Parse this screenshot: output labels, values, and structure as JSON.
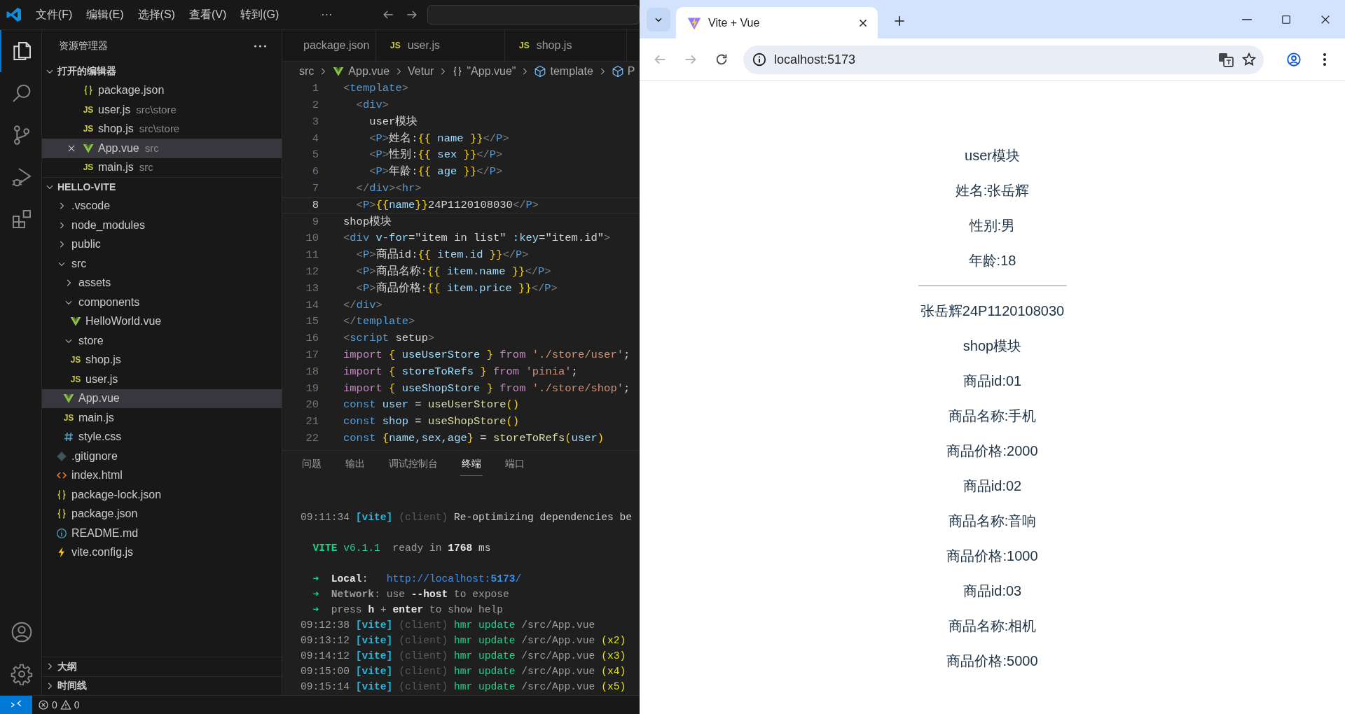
{
  "vscode": {
    "menu": [
      "文件(F)",
      "编辑(E)",
      "选择(S)",
      "查看(V)",
      "转到(G)",
      "···"
    ],
    "activity_bar": [
      {
        "kind": "explorer",
        "selected": true
      },
      {
        "kind": "search",
        "selected": false
      },
      {
        "kind": "source-control",
        "selected": false
      },
      {
        "kind": "run-debug",
        "selected": false
      },
      {
        "kind": "extensions",
        "selected": false
      }
    ],
    "sidebar": {
      "title": "资源管理器",
      "sections": [
        {
          "kind": "open-editors",
          "title": "打开的编辑器",
          "expanded": true,
          "items": [
            {
              "kind": "json",
              "name": "package.json",
              "selected": false
            },
            {
              "kind": "js",
              "icon_text": "JS",
              "name": "user.js",
              "path": "src\\store",
              "selected": false
            },
            {
              "kind": "js",
              "icon_text": "JS",
              "name": "shop.js",
              "path": "src\\store",
              "selected": false
            },
            {
              "kind": "vue",
              "name": "App.vue",
              "path": "src",
              "selected": true
            },
            {
              "kind": "js",
              "icon_text": "JS",
              "name": "main.js",
              "path": "src",
              "selected": false
            }
          ]
        },
        {
          "kind": "tree",
          "title": "HELLO-VITE",
          "expanded": true,
          "items": [
            {
              "kind": "folder",
              "name": ".vscode",
              "expanded": false,
              "selected": false
            },
            {
              "kind": "folder",
              "name": "node_modules",
              "expanded": false,
              "selected": false
            },
            {
              "kind": "folder",
              "name": "public",
              "expanded": false,
              "selected": false
            },
            {
              "kind": "folder",
              "name": "src",
              "expanded": true,
              "selected": false,
              "children": [
                {
                  "kind": "folder",
                  "name": "assets",
                  "expanded": false,
                  "selected": false
                },
                {
                  "kind": "folder",
                  "name": "components",
                  "expanded": true,
                  "selected": false,
                  "children": [
                    {
                      "kind": "vue",
                      "name": "HelloWorld.vue",
                      "selected": false
                    }
                  ]
                },
                {
                  "kind": "folder",
                  "name": "store",
                  "expanded": true,
                  "selected": false,
                  "children": [
                    {
                      "kind": "js",
                      "icon_text": "JS",
                      "name": "shop.js",
                      "selected": false
                    },
                    {
                      "kind": "js",
                      "icon_text": "JS",
                      "name": "user.js",
                      "selected": false
                    }
                  ]
                },
                {
                  "kind": "vue",
                  "name": "App.vue",
                  "selected": true
                },
                {
                  "kind": "js",
                  "icon_text": "JS",
                  "name": "main.js",
                  "selected": false
                },
                {
                  "kind": "css",
                  "name": "style.css",
                  "selected": false
                }
              ]
            },
            {
              "kind": "git",
              "name": ".gitignore",
              "selected": false
            },
            {
              "kind": "html",
              "name": "index.html",
              "selected": false
            },
            {
              "kind": "json",
              "name": "package-lock.json",
              "selected": false
            },
            {
              "kind": "json",
              "name": "package.json",
              "selected": false
            },
            {
              "kind": "info",
              "name": "README.md",
              "selected": false
            },
            {
              "kind": "vite",
              "name": "vite.config.js",
              "selected": false
            }
          ]
        },
        {
          "title": "大纲",
          "expanded": false
        },
        {
          "title": "时间线",
          "expanded": false
        }
      ]
    },
    "editor_tabs": [
      {
        "kind": "json",
        "label": "package.json",
        "selected": false
      },
      {
        "kind": "js",
        "icon_text": "JS",
        "label": "user.js",
        "selected": false
      },
      {
        "kind": "js",
        "icon_text": "JS",
        "label": "shop.js",
        "selected": false
      }
    ],
    "breadcrumb": [
      {
        "kind": "plain",
        "text": "src"
      },
      {
        "kind": "vue",
        "text": "App.vue"
      },
      {
        "kind": "plain",
        "text": "Vetur"
      },
      {
        "kind": "braces",
        "text": "\"App.vue\""
      },
      {
        "kind": "cube",
        "text": "template"
      },
      {
        "kind": "cube",
        "text": "P"
      }
    ],
    "code": [
      {
        "number": "1",
        "current": false,
        "segments": [
          {
            "text": "<",
            "kind": "p"
          },
          {
            "text": "template",
            "kind": "tag"
          },
          {
            "text": ">",
            "kind": "p"
          }
        ]
      },
      {
        "number": "2",
        "current": false,
        "segments": [
          {
            "text": "  <",
            "kind": "p"
          },
          {
            "text": "div",
            "kind": "tag"
          },
          {
            "text": ">",
            "kind": "p"
          }
        ]
      },
      {
        "number": "3",
        "current": false,
        "segments": [
          {
            "text": "    user模块",
            "kind": "tx"
          }
        ]
      },
      {
        "number": "4",
        "current": false,
        "segments": [
          {
            "text": "    <",
            "kind": "p"
          },
          {
            "text": "P",
            "kind": "tag"
          },
          {
            "text": ">",
            "kind": "p"
          },
          {
            "text": "姓名:",
            "kind": "tx"
          },
          {
            "text": "{{",
            "kind": "br"
          },
          {
            "text": " name ",
            "kind": "v"
          },
          {
            "text": "}}",
            "kind": "br"
          },
          {
            "text": "</",
            "kind": "p"
          },
          {
            "text": "P",
            "kind": "tag"
          },
          {
            "text": ">",
            "kind": "p"
          }
        ]
      },
      {
        "number": "5",
        "current": false,
        "segments": [
          {
            "text": "    <",
            "kind": "p"
          },
          {
            "text": "P",
            "kind": "tag"
          },
          {
            "text": ">",
            "kind": "p"
          },
          {
            "text": "性别:",
            "kind": "tx"
          },
          {
            "text": "{{",
            "kind": "br"
          },
          {
            "text": " sex ",
            "kind": "v"
          },
          {
            "text": "}}",
            "kind": "br"
          },
          {
            "text": "</",
            "kind": "p"
          },
          {
            "text": "P",
            "kind": "tag"
          },
          {
            "text": ">",
            "kind": "p"
          }
        ]
      },
      {
        "number": "6",
        "current": false,
        "segments": [
          {
            "text": "    <",
            "kind": "p"
          },
          {
            "text": "P",
            "kind": "tag"
          },
          {
            "text": ">",
            "kind": "p"
          },
          {
            "text": "年龄:",
            "kind": "tx"
          },
          {
            "text": "{{",
            "kind": "br"
          },
          {
            "text": " age ",
            "kind": "v"
          },
          {
            "text": "}}",
            "kind": "br"
          },
          {
            "text": "</",
            "kind": "p"
          },
          {
            "text": "P",
            "kind": "tag"
          },
          {
            "text": ">",
            "kind": "p"
          }
        ]
      },
      {
        "number": "7",
        "current": false,
        "segments": [
          {
            "text": "  </",
            "kind": "p"
          },
          {
            "text": "div",
            "kind": "tag"
          },
          {
            "text": "><",
            "kind": "p"
          },
          {
            "text": "hr",
            "kind": "tag"
          },
          {
            "text": ">",
            "kind": "p"
          }
        ]
      },
      {
        "number": "8",
        "current": true,
        "segments": [
          {
            "text": "  <",
            "kind": "p"
          },
          {
            "text": "P",
            "kind": "tag"
          },
          {
            "text": ">",
            "kind": "p"
          },
          {
            "text": "{{",
            "kind": "br"
          },
          {
            "text": "name",
            "kind": "v"
          },
          {
            "text": "}}",
            "kind": "br"
          },
          {
            "text": "24P1120108030",
            "kind": "tx"
          },
          {
            "text": "</",
            "kind": "p"
          },
          {
            "text": "P",
            "kind": "tag"
          },
          {
            "text": ">",
            "kind": "p"
          }
        ]
      },
      {
        "number": "9",
        "current": false,
        "segments": [
          {
            "text": "shop模块",
            "kind": "tx"
          }
        ]
      },
      {
        "number": "10",
        "current": false,
        "segments": [
          {
            "text": "<",
            "kind": "p"
          },
          {
            "text": "div",
            "kind": "tag"
          },
          {
            "text": " v-for",
            "kind": "v"
          },
          {
            "text": "=\"item in list\"",
            "kind": "tx"
          },
          {
            "text": " :key",
            "kind": "v"
          },
          {
            "text": "=\"item.id\"",
            "kind": "tx"
          },
          {
            "text": ">",
            "kind": "p"
          }
        ]
      },
      {
        "number": "11",
        "current": false,
        "segments": [
          {
            "text": "  <",
            "kind": "p"
          },
          {
            "text": "P",
            "kind": "tag"
          },
          {
            "text": ">",
            "kind": "p"
          },
          {
            "text": "商品id:",
            "kind": "tx"
          },
          {
            "text": "{{",
            "kind": "br"
          },
          {
            "text": " item.id ",
            "kind": "v"
          },
          {
            "text": "}}",
            "kind": "br"
          },
          {
            "text": "</",
            "kind": "p"
          },
          {
            "text": "P",
            "kind": "tag"
          },
          {
            "text": ">",
            "kind": "p"
          }
        ]
      },
      {
        "number": "12",
        "current": false,
        "segments": [
          {
            "text": "  <",
            "kind": "p"
          },
          {
            "text": "P",
            "kind": "tag"
          },
          {
            "text": ">",
            "kind": "p"
          },
          {
            "text": "商品名称:",
            "kind": "tx"
          },
          {
            "text": "{{",
            "kind": "br"
          },
          {
            "text": " item.name ",
            "kind": "v"
          },
          {
            "text": "}}",
            "kind": "br"
          },
          {
            "text": "</",
            "kind": "p"
          },
          {
            "text": "P",
            "kind": "tag"
          },
          {
            "text": ">",
            "kind": "p"
          }
        ]
      },
      {
        "number": "13",
        "current": false,
        "segments": [
          {
            "text": "  <",
            "kind": "p"
          },
          {
            "text": "P",
            "kind": "tag"
          },
          {
            "text": ">",
            "kind": "p"
          },
          {
            "text": "商品价格:",
            "kind": "tx"
          },
          {
            "text": "{{",
            "kind": "br"
          },
          {
            "text": " item.price ",
            "kind": "v"
          },
          {
            "text": "}}",
            "kind": "br"
          },
          {
            "text": "</",
            "kind": "p"
          },
          {
            "text": "P",
            "kind": "tag"
          },
          {
            "text": ">",
            "kind": "p"
          }
        ]
      },
      {
        "number": "14",
        "current": false,
        "segments": [
          {
            "text": "</",
            "kind": "p"
          },
          {
            "text": "div",
            "kind": "tag"
          },
          {
            "text": ">",
            "kind": "p"
          }
        ]
      },
      {
        "number": "15",
        "current": false,
        "segments": [
          {
            "text": "</",
            "kind": "p"
          },
          {
            "text": "template",
            "kind": "tag"
          },
          {
            "text": ">",
            "kind": "p"
          }
        ]
      },
      {
        "number": "16",
        "current": false,
        "segments": [
          {
            "text": "<",
            "kind": "p"
          },
          {
            "text": "script",
            "kind": "tag"
          },
          {
            "text": " setup",
            "kind": "tx"
          },
          {
            "text": ">",
            "kind": "p"
          }
        ]
      },
      {
        "number": "17",
        "current": false,
        "segments": [
          {
            "text": "import",
            "kind": "kw"
          },
          {
            "text": " {",
            "kind": "br"
          },
          {
            "text": " useUserStore ",
            "kind": "v"
          },
          {
            "text": "}",
            "kind": "br"
          },
          {
            "text": " from",
            "kind": "kw"
          },
          {
            "text": " './store/user'",
            "kind": "s"
          },
          {
            "text": ";",
            "kind": "tx"
          }
        ]
      },
      {
        "number": "18",
        "current": false,
        "segments": [
          {
            "text": "import",
            "kind": "kw"
          },
          {
            "text": " {",
            "kind": "br"
          },
          {
            "text": " storeToRefs ",
            "kind": "v"
          },
          {
            "text": "}",
            "kind": "br"
          },
          {
            "text": " from",
            "kind": "kw"
          },
          {
            "text": " 'pinia'",
            "kind": "s"
          },
          {
            "text": ";",
            "kind": "tx"
          }
        ]
      },
      {
        "number": "19",
        "current": false,
        "segments": [
          {
            "text": "import",
            "kind": "kw"
          },
          {
            "text": " {",
            "kind": "br"
          },
          {
            "text": " useShopStore ",
            "kind": "v"
          },
          {
            "text": "}",
            "kind": "br"
          },
          {
            "text": " from",
            "kind": "kw"
          },
          {
            "text": " './store/shop'",
            "kind": "s"
          },
          {
            "text": ";",
            "kind": "tx"
          }
        ]
      },
      {
        "number": "20",
        "current": false,
        "segments": [
          {
            "text": "const",
            "kind": "c"
          },
          {
            "text": " user",
            "kind": "v"
          },
          {
            "text": " = ",
            "kind": "tx"
          },
          {
            "text": "useUserStore",
            "kind": "fn"
          },
          {
            "text": "()",
            "kind": "br"
          }
        ]
      },
      {
        "number": "21",
        "current": false,
        "segments": [
          {
            "text": "const",
            "kind": "c"
          },
          {
            "text": " shop",
            "kind": "v"
          },
          {
            "text": " = ",
            "kind": "tx"
          },
          {
            "text": "useShopStore",
            "kind": "fn"
          },
          {
            "text": "()",
            "kind": "br"
          }
        ]
      },
      {
        "number": "22",
        "current": false,
        "segments": [
          {
            "text": "const",
            "kind": "c"
          },
          {
            "text": " {",
            "kind": "br"
          },
          {
            "text": "name,sex,age",
            "kind": "v"
          },
          {
            "text": "}",
            "kind": "br"
          },
          {
            "text": " = ",
            "kind": "tx"
          },
          {
            "text": "storeToRefs",
            "kind": "fn"
          },
          {
            "text": "(",
            "kind": "br"
          },
          {
            "text": "user",
            "kind": "v"
          },
          {
            "text": ")",
            "kind": "br"
          }
        ]
      }
    ],
    "panel_tabs": [
      {
        "label": "问题",
        "selected": false
      },
      {
        "label": "输出",
        "selected": false
      },
      {
        "label": "调试控制台",
        "selected": false
      },
      {
        "label": "终端",
        "selected": true
      },
      {
        "label": "端口",
        "selected": false
      }
    ],
    "terminal": [
      {
        "kind": "log",
        "segments": [
          {
            "text": "09:11:34 ",
            "kind": "dim"
          },
          {
            "text": "[vite]",
            "kind": "cyan"
          },
          {
            "text": " (client) ",
            "kind": "dark"
          },
          {
            "text": "Re-optimizing dependencies be",
            "kind": "tx"
          }
        ]
      },
      {
        "kind": "blank"
      },
      {
        "kind": "log",
        "segments": [
          {
            "text": "  VITE",
            "kind": "greenb"
          },
          {
            "text": " v6.1.1",
            "kind": "green"
          },
          {
            "text": "  ready in ",
            "kind": "dim"
          },
          {
            "text": "1768",
            "kind": "bold"
          },
          {
            "text": " ms",
            "kind": "tx"
          }
        ]
      },
      {
        "kind": "blank"
      },
      {
        "kind": "log",
        "segments": [
          {
            "text": "  ➜  ",
            "kind": "green"
          },
          {
            "text": "Local",
            "kind": "bold"
          },
          {
            "text": ":   ",
            "kind": "tx"
          },
          {
            "text": "http://localhost:",
            "kind": "link"
          },
          {
            "text": "5173",
            "kind": "linkb"
          },
          {
            "text": "/",
            "kind": "link"
          }
        ]
      },
      {
        "kind": "log",
        "segments": [
          {
            "text": "  ➜  ",
            "kind": "green"
          },
          {
            "text": "Network",
            "kind": "dimb"
          },
          {
            "text": ": use ",
            "kind": "dim"
          },
          {
            "text": "--host",
            "kind": "bold"
          },
          {
            "text": " to expose",
            "kind": "dim"
          }
        ]
      },
      {
        "kind": "log",
        "segments": [
          {
            "text": "  ➜  ",
            "kind": "green"
          },
          {
            "text": "press ",
            "kind": "dim"
          },
          {
            "text": "h",
            "kind": "bold"
          },
          {
            "text": " + ",
            "kind": "dim"
          },
          {
            "text": "enter",
            "kind": "bold"
          },
          {
            "text": " to show help",
            "kind": "dim"
          }
        ]
      },
      {
        "kind": "log",
        "segments": [
          {
            "text": "09:12:38 ",
            "kind": "dim"
          },
          {
            "text": "[vite]",
            "kind": "cyan"
          },
          {
            "text": " (client) ",
            "kind": "dark"
          },
          {
            "text": "hmr update",
            "kind": "green"
          },
          {
            "text": " /src/App.vue",
            "kind": "dim"
          }
        ]
      },
      {
        "kind": "log",
        "segments": [
          {
            "text": "09:13:12 ",
            "kind": "dim"
          },
          {
            "text": "[vite]",
            "kind": "cyan"
          },
          {
            "text": " (client) ",
            "kind": "dark"
          },
          {
            "text": "hmr update",
            "kind": "green"
          },
          {
            "text": " /src/App.vue",
            "kind": "dim"
          },
          {
            "text": " (x2)",
            "kind": "yellow"
          }
        ]
      },
      {
        "kind": "log",
        "segments": [
          {
            "text": "09:14:12 ",
            "kind": "dim"
          },
          {
            "text": "[vite]",
            "kind": "cyan"
          },
          {
            "text": " (client) ",
            "kind": "dark"
          },
          {
            "text": "hmr update",
            "kind": "green"
          },
          {
            "text": " /src/App.vue",
            "kind": "dim"
          },
          {
            "text": " (x3)",
            "kind": "yellow"
          }
        ]
      },
      {
        "kind": "log",
        "segments": [
          {
            "text": "09:15:00 ",
            "kind": "dim"
          },
          {
            "text": "[vite]",
            "kind": "cyan"
          },
          {
            "text": " (client) ",
            "kind": "dark"
          },
          {
            "text": "hmr update",
            "kind": "green"
          },
          {
            "text": " /src/App.vue",
            "kind": "dim"
          },
          {
            "text": " (x4)",
            "kind": "yellow"
          }
        ]
      },
      {
        "kind": "log",
        "segments": [
          {
            "text": "09:15:14 ",
            "kind": "dim"
          },
          {
            "text": "[vite]",
            "kind": "cyan"
          },
          {
            "text": " (client) ",
            "kind": "dark"
          },
          {
            "text": "hmr update",
            "kind": "green"
          },
          {
            "text": " /src/App.vue",
            "kind": "dim"
          },
          {
            "text": " (x5)",
            "kind": "yellow"
          }
        ]
      }
    ],
    "status_bar": {
      "errors": "0",
      "warnings": "0"
    }
  },
  "browser": {
    "tabs": [
      {
        "title": "Vite + Vue",
        "selected": true
      }
    ],
    "back_disabled": true,
    "forward_disabled": true,
    "address": "localhost:5173",
    "page": [
      {
        "kind": "text",
        "text": "user模块"
      },
      {
        "kind": "text",
        "text": "姓名:张岳辉"
      },
      {
        "kind": "text",
        "text": "性别:男"
      },
      {
        "kind": "text",
        "text": "年龄:18"
      },
      {
        "kind": "rule"
      },
      {
        "kind": "text",
        "text": "张岳辉24P1120108030"
      },
      {
        "kind": "text",
        "text": "shop模块"
      },
      {
        "kind": "text",
        "text": "商品id:01"
      },
      {
        "kind": "text",
        "text": "商品名称:手机"
      },
      {
        "kind": "text",
        "text": "商品价格:2000"
      },
      {
        "kind": "text",
        "text": "商品id:02"
      },
      {
        "kind": "text",
        "text": "商品名称:音响"
      },
      {
        "kind": "text",
        "text": "商品价格:1000"
      },
      {
        "kind": "text",
        "text": "商品id:03"
      },
      {
        "kind": "text",
        "text": "商品名称:相机"
      },
      {
        "kind": "text",
        "text": "商品价格:5000"
      }
    ]
  }
}
